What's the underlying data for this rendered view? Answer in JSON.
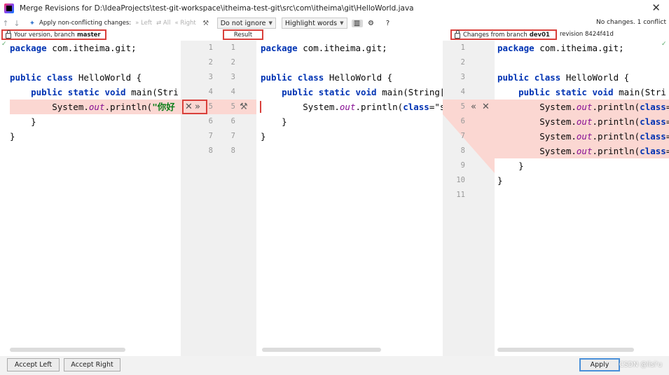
{
  "window": {
    "title": "Merge Revisions for D:\\IdeaProjects\\test-git-workspace\\itheima-test-git\\src\\com\\itheima\\git\\HelloWorld.java"
  },
  "toolbar": {
    "apply_non_conflicting": "Apply non-conflicting changes:",
    "left": "Left",
    "all": "All",
    "right": "Right",
    "ignore_whitespace": "Do not ignore",
    "highlight": "Highlight words",
    "help": "?",
    "status": "No changes. 1 conflict"
  },
  "headers": {
    "left_prefix": "Your version, branch",
    "left_branch": "master",
    "result": "Result",
    "right_prefix": "Changes from branch",
    "right_branch": "dev01",
    "right_revision": "revision 8424f41d"
  },
  "left_panel": {
    "lines": [
      {
        "pre": "package ",
        "kw": "",
        "text": "com.itheima.git;",
        "is_pkg": true
      },
      {
        "text": ""
      },
      {
        "text": "public class HelloWorld {"
      },
      {
        "text": "    public static void main(Stri"
      },
      {
        "text": "        System.out.println(\"你好"
      },
      {
        "text": "    }"
      },
      {
        "text": "}"
      }
    ]
  },
  "result_panel": {
    "lines": [
      "package com.itheima.git;",
      "",
      "public class HelloWorld {",
      "    public static void main(String[",
      "        System.out.println(\"HelloWo",
      "    }",
      "}"
    ]
  },
  "right_panel": {
    "lines": [
      "package com.itheima.git;",
      "",
      "public class HelloWorld {",
      "    public static void main(Stri",
      "        System.out.println(\"Hell",
      "        System.out.println(\"新增",
      "        System.out.println(\"新增",
      "        System.out.println(\"新增.",
      "    }",
      "}",
      ""
    ]
  },
  "gutter": {
    "left_numbers": [
      "1",
      "2",
      "3",
      "4",
      "5",
      "6",
      "7",
      "8"
    ],
    "result_numbers": [
      "1",
      "2",
      "3",
      "4",
      "5",
      "6",
      "7",
      "8"
    ],
    "right_numbers": [
      "1",
      "2",
      "3",
      "4",
      "5",
      "6",
      "7",
      "8",
      "9",
      "10",
      "11"
    ]
  },
  "buttons": {
    "accept_left": "Accept Left",
    "accept_right": "Accept Right",
    "apply": "Apply"
  },
  "watermark": "CSDN @lisi'u",
  "colors": {
    "conflict_highlight": "#fbd7d2",
    "annotation_red": "#d9403b",
    "keyword": "#0033b3",
    "string": "#067d17",
    "field": "#871094"
  }
}
